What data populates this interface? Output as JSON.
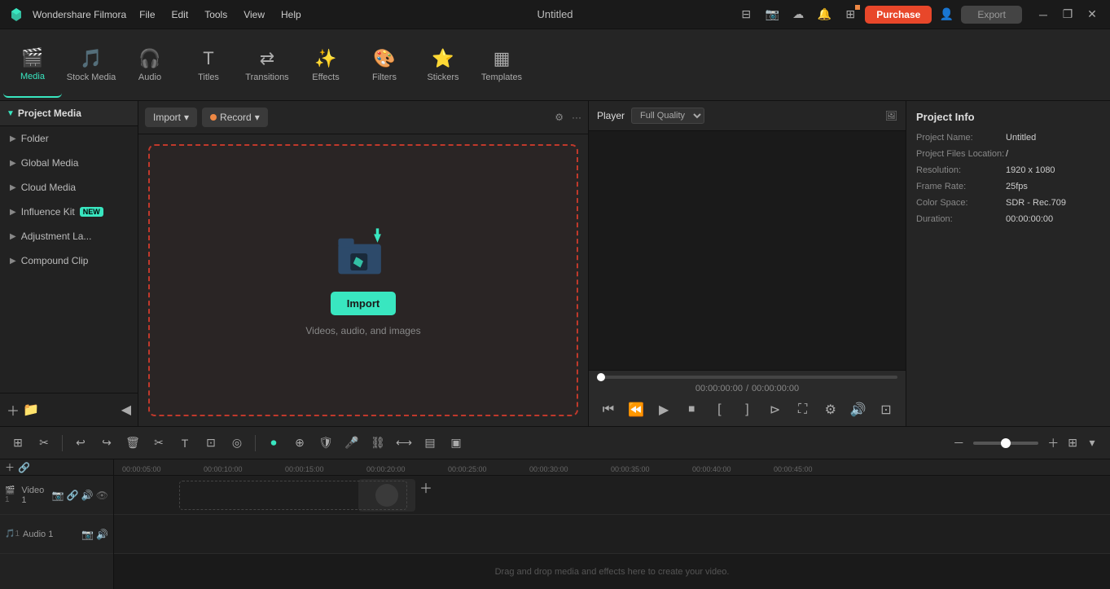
{
  "app": {
    "name": "Wondershare Filmora",
    "title": "Untitled"
  },
  "titlebar": {
    "menus": [
      "File",
      "Edit",
      "Tools",
      "View",
      "Help"
    ],
    "purchase_label": "Purchase",
    "export_label": "Export",
    "win_controls": [
      "─",
      "❐",
      "✕"
    ]
  },
  "toolbar": {
    "items": [
      {
        "id": "media",
        "label": "Media",
        "active": true
      },
      {
        "id": "stock-media",
        "label": "Stock Media",
        "active": false
      },
      {
        "id": "audio",
        "label": "Audio",
        "active": false
      },
      {
        "id": "titles",
        "label": "Titles",
        "active": false
      },
      {
        "id": "transitions",
        "label": "Transitions",
        "active": false
      },
      {
        "id": "effects",
        "label": "Effects",
        "active": false
      },
      {
        "id": "filters",
        "label": "Filters",
        "active": false
      },
      {
        "id": "stickers",
        "label": "Stickers",
        "active": false
      },
      {
        "id": "templates",
        "label": "Templates",
        "active": false
      }
    ]
  },
  "left_panel": {
    "header": "Project Media",
    "items": [
      {
        "id": "folder",
        "label": "Folder"
      },
      {
        "id": "global-media",
        "label": "Global Media"
      },
      {
        "id": "cloud-media",
        "label": "Cloud Media"
      },
      {
        "id": "influence-kit",
        "label": "Influence Kit",
        "badge": "NEW"
      },
      {
        "id": "adjustment-la",
        "label": "Adjustment La..."
      },
      {
        "id": "compound-clip",
        "label": "Compound Clip"
      }
    ]
  },
  "media_panel": {
    "import_label": "Import",
    "record_label": "Record",
    "drop_text": "Videos, audio, and images",
    "import_btn_label": "Import"
  },
  "player": {
    "tab_player": "Player",
    "quality": "Full Quality",
    "time_current": "00:00:00:00",
    "time_total": "00:00:00:00"
  },
  "project_info": {
    "title": "Project Info",
    "fields": [
      {
        "label": "Project Name:",
        "value": "Untitled"
      },
      {
        "label": "Project Files Location:",
        "value": "/"
      },
      {
        "label": "Resolution:",
        "value": "1920 x 1080"
      },
      {
        "label": "Frame Rate:",
        "value": "25fps"
      },
      {
        "label": "Color Space:",
        "value": "SDR - Rec.709"
      },
      {
        "label": "Duration:",
        "value": "00:00:00:00"
      }
    ]
  },
  "timeline": {
    "tracks": [
      {
        "label": "Video 1",
        "icons": [
          "📸",
          "🔗",
          "🔊",
          "👁"
        ]
      },
      {
        "label": "Audio 1",
        "icons": [
          "📸",
          "🔊"
        ]
      }
    ],
    "ruler_marks": [
      "00:00:05:00",
      "00:00:10:00",
      "00:00:15:00",
      "00:00:20:00",
      "00:00:25:00",
      "00:00:30:00",
      "00:00:35:00",
      "00:00:40:00",
      "00:00:45:00"
    ],
    "drop_text": "Drag and drop media and effects here to create your video."
  }
}
